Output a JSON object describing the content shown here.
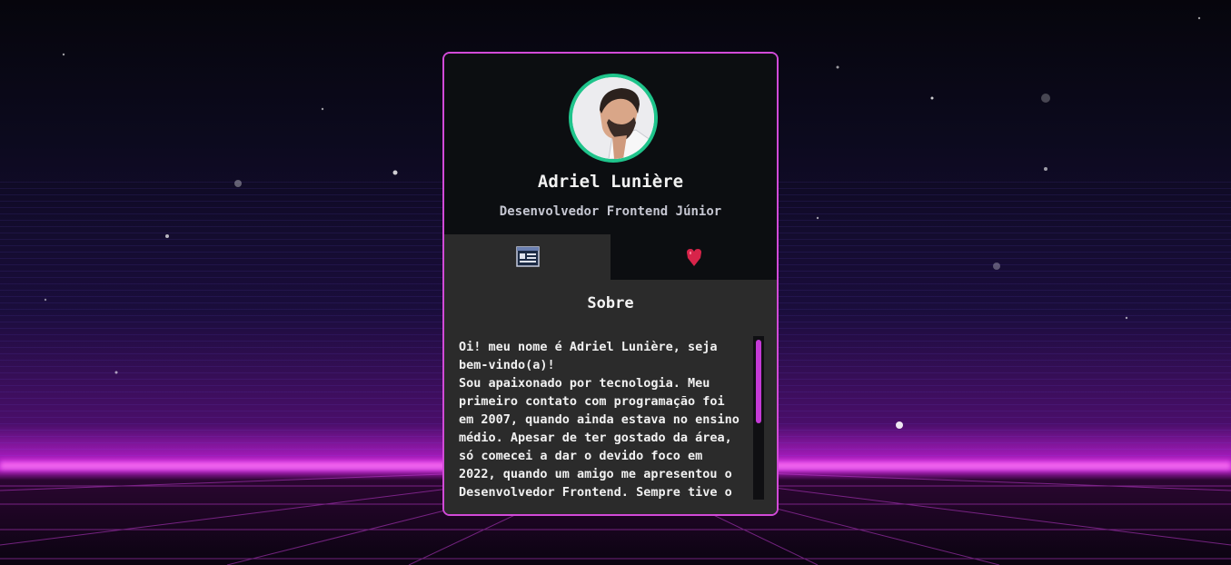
{
  "theme": {
    "card_border": "#d24ad8",
    "avatar_ring": "#1fc48b",
    "scrollbar_thumb": "#c43ad6",
    "background": "synthwave-grid"
  },
  "profile": {
    "avatar_icon": "avatar-photo",
    "name": "Adriel Lunière",
    "role": "Desenvolvedor Frontend Júnior"
  },
  "tabs": [
    {
      "icon": "profile-card-icon",
      "active": true
    },
    {
      "icon": "heart-icon",
      "active": false
    }
  ],
  "about": {
    "title": "Sobre",
    "paragraphs": [
      "Oi! meu nome é Adriel Lunière, seja bem-vindo(a)!",
      "Sou apaixonado por tecnologia. Meu primeiro contato com programação foi em 2007, quando ainda estava no ensino médio. Apesar de ter gostado da área, só comecei a dar o devido foco em 2022, quando um amigo me apresentou o Desenvolvedor Frontend. Sempre tive o"
    ]
  }
}
